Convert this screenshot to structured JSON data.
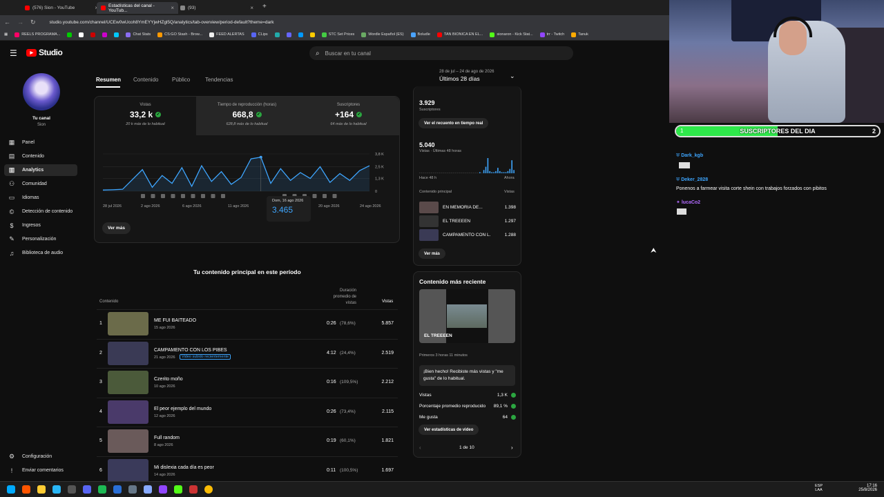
{
  "browser": {
    "tabs": [
      {
        "label": "(576) Sion - YouTube"
      },
      {
        "label": "Estadísticas del canal - YouTub..."
      },
      {
        "label": "(93)"
      }
    ],
    "url": "studio.youtube.com/channel/UCEw0wUcoh8YmEYYjwHZgl5Q/analytics/tab-overview/period-default?theme=dark",
    "bookmarks": [
      "REELS PROGRAMA...",
      "Chat Stats",
      "CS:GO Stash - Brow...",
      "FEED ALERTAS",
      "CLips",
      "STC Set Prices",
      "Wordle Español (ES)",
      "Boludle",
      "TAN BIONICA EN EL...",
      "sionaron - Kick Stat...",
      "trr - Twitch",
      "Tanuk"
    ]
  },
  "studio": {
    "logo_text": "Studio",
    "search_placeholder": "Buscar en tu canal",
    "channel_label": "Tu canal",
    "channel_name": "Sion",
    "nav": [
      {
        "label": "Panel",
        "icon": "dashboard-icon"
      },
      {
        "label": "Contenido",
        "icon": "content-icon"
      },
      {
        "label": "Analytics",
        "icon": "analytics-icon"
      },
      {
        "label": "Comunidad",
        "icon": "community-icon"
      },
      {
        "label": "Idiomas",
        "icon": "subtitles-icon"
      },
      {
        "label": "Detección de contenido",
        "icon": "copyright-icon"
      },
      {
        "label": "Ingresos",
        "icon": "earn-icon"
      },
      {
        "label": "Personalización",
        "icon": "customization-icon"
      },
      {
        "label": "Biblioteca de audio",
        "icon": "audio-library-icon"
      }
    ],
    "nav_bottom": [
      {
        "label": "Configuración",
        "icon": "gear-icon"
      },
      {
        "label": "Enviar comentarios",
        "icon": "feedback-icon"
      }
    ],
    "tabs": [
      "Resumen",
      "Contenido",
      "Público",
      "Tendencias"
    ],
    "date_range": "28 de jul – 24 de ago de 2026",
    "period": "Últimos 28 días",
    "metrics": [
      {
        "label": "Vistas",
        "value": "33,2 k",
        "sub": "20 k más de lo habitual"
      },
      {
        "label": "Tiempo de reproducción (horas)",
        "value": "668,8",
        "sub": "628,8 más de lo habitual"
      },
      {
        "label": "Suscriptores",
        "value": "+164",
        "sub": "64 más de lo habitual"
      }
    ],
    "ver_mas": "Ver más",
    "tooltip": {
      "date": "Dom, 16 ago 2026",
      "value": "3.465"
    },
    "top_content": {
      "title": "Tu contenido principal en este período",
      "col_content": "Contenido",
      "col_duration": "Duración promedio de vistas",
      "col_views": "Vistas",
      "rows": [
        {
          "rank": "1",
          "title": "ME FUI BAITEADO",
          "date": "15 ago 2026",
          "badge": "",
          "dur": "0:26",
          "pct": "(78,6%)",
          "views": "5.857"
        },
        {
          "rank": "2",
          "title": "CAMPAMENTO CON LOS PIBES",
          "date": "21 ago 2026",
          "badge": "Video subido recientemente",
          "dur": "4:12",
          "pct": "(24,4%)",
          "views": "2.519"
        },
        {
          "rank": "3",
          "title": "Czerito moño",
          "date": "10 ago 2026",
          "badge": "",
          "dur": "0:16",
          "pct": "(109,5%)",
          "views": "2.212"
        },
        {
          "rank": "4",
          "title": "El peor ejemplo del mundo",
          "date": "12 ago 2026",
          "badge": "",
          "dur": "0:26",
          "pct": "(73,4%)",
          "views": "2.115"
        },
        {
          "rank": "5",
          "title": "Full random",
          "date": "8 ago 2026",
          "badge": "",
          "dur": "0:19",
          "pct": "(60,1%)",
          "views": "1.821"
        },
        {
          "rank": "6",
          "title": "Mi dislexia cada día es peor",
          "date": "14 ago 2026",
          "badge": "",
          "dur": "0:11",
          "pct": "(100,5%)",
          "views": "1.697"
        }
      ]
    },
    "realtime": {
      "subs": "3.929",
      "subs_label": "Suscriptores",
      "realtime_button": "Ver el recuento en tiempo real",
      "views": "5.040",
      "views_label": "Vistas · Últimas 48 horas",
      "left_axis": "Hace 48 h",
      "right_axis": "Ahora",
      "col_content": "Contenido principal",
      "col_views": "Vistas",
      "rows": [
        {
          "title": "EN MEMORIA DE...",
          "views": "1.398"
        },
        {
          "title": "EL TREEEEN",
          "views": "1.297"
        },
        {
          "title": "CAMPAMENTO CON L...",
          "views": "1.288"
        }
      ],
      "ver_mas": "Ver más"
    },
    "recent": {
      "title": "Contenido más reciente",
      "video_title": "EL TREEEEN",
      "first": "Primeros 3 horas 11 minutos",
      "note": "¡Bien hecho! Recibiste más vistas y \"me gusta\" de lo habitual.",
      "stats": [
        {
          "label": "Vistas",
          "value": "1,3 K"
        },
        {
          "label": "Porcentaje promedio reproducido",
          "value": "89,1 %"
        },
        {
          "label": "Me gusta",
          "value": "64"
        }
      ],
      "button": "Ver estadísticas de video",
      "pager": "1 de 10"
    }
  },
  "chart_data": {
    "type": "line",
    "x_labels": [
      "28 jul 2026",
      "2 ago 2026",
      "6 ago 2026",
      "11 ago 2026",
      "20 ago 2026",
      "24 ago 2026"
    ],
    "y_ticks": [
      "3,8 K",
      "2,5 K",
      "1,3 K",
      "0"
    ],
    "ylim": [
      0,
      3800
    ],
    "values": [
      120,
      150,
      200,
      1200,
      2200,
      400,
      1600,
      800,
      2400,
      500,
      2600,
      1000,
      2000,
      700,
      1400,
      3300,
      3465,
      800,
      2300,
      1100,
      1900,
      1300,
      2500,
      900,
      1800,
      1100,
      2100,
      2600
    ]
  },
  "realtime_bars": [
    0,
    0,
    0,
    0,
    0,
    0,
    0,
    0,
    0,
    0,
    0,
    0,
    0,
    0,
    0,
    0,
    0,
    0,
    0,
    0,
    0,
    0,
    0,
    0,
    0,
    0,
    0,
    0,
    0,
    0,
    1,
    0,
    3,
    6,
    14,
    2,
    1,
    1,
    2,
    5,
    2,
    1,
    1,
    1,
    2,
    4,
    12,
    3
  ],
  "overlay": {
    "subs_title": "SUSCRIPTORES DEL DIA",
    "subs_min": "1",
    "subs_max": "2",
    "subs_fill": 0.5,
    "chat": [
      {
        "user": "Dark_kgb",
        "color": "#3ea6ff",
        "msg": ""
      },
      {
        "user": "Deker_2828",
        "color": "#3ea6ff",
        "msg": "Ponenos a farmear visita corte shein con trabajos forzados con pibitos"
      },
      {
        "user": "lucaCo2",
        "color": "#b26bff",
        "msg": ""
      }
    ]
  },
  "taskbar": {
    "lang1": "ESP",
    "lang2": "LAA",
    "time": "17:16",
    "date": "25/8/2026"
  }
}
